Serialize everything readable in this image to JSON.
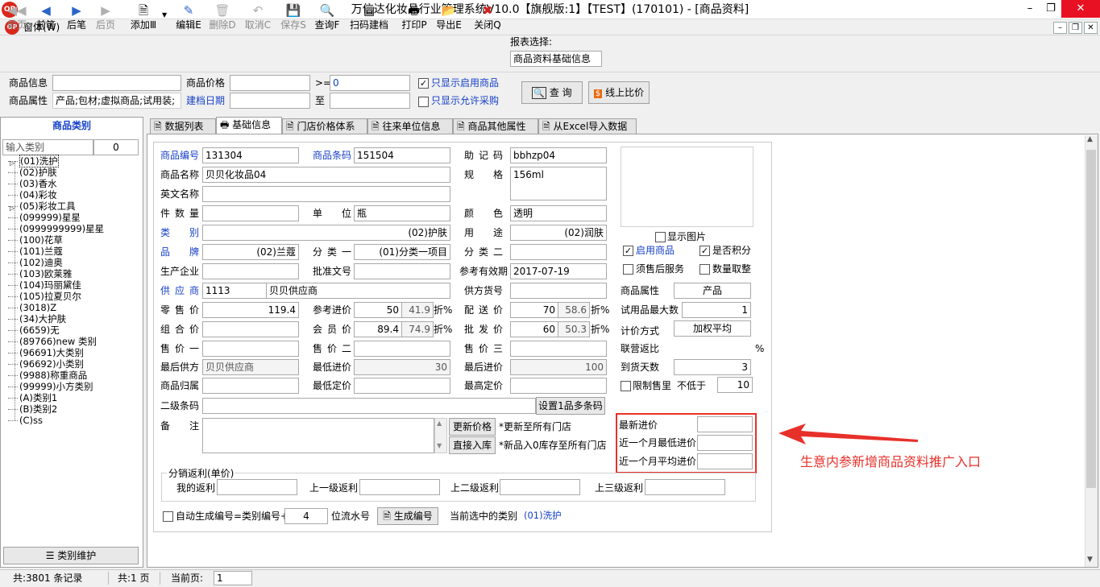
{
  "window": {
    "title": "万信达化妆品行业管理系统V10.0【旗舰版:1】【TEST】(170101) - [商品资料]",
    "menu_label": "窗体(W)"
  },
  "toolbar": {
    "buttons": [
      {
        "label": "前页"
      },
      {
        "label": "前笔"
      },
      {
        "label": "后笔"
      },
      {
        "label": "后页"
      },
      {
        "label": "添加Ⅲ"
      },
      {
        "label": "编辑E"
      },
      {
        "label": "删除D"
      },
      {
        "label": "取消C"
      },
      {
        "label": "保存S"
      },
      {
        "label": "查询F"
      },
      {
        "label": "扫码建档"
      },
      {
        "label": "打印P"
      },
      {
        "label": "导出E"
      },
      {
        "label": "关闭Q"
      }
    ],
    "report_label": "报表选择:",
    "report_value": "商品资料基础信息"
  },
  "filter": {
    "goods_info_label": "商品信息",
    "goods_price_label": "商品价格",
    "ge_label": ">=",
    "price_value": "0",
    "only_enabled_label": "只显示启用商品",
    "goods_attr_label": "商品属性",
    "goods_attr_value": "产品;包材;虚拟商品;试用装;",
    "create_date_label": "建档日期",
    "to_label": "至",
    "only_purchase_label": "只显示允许采购",
    "query_btn": "查 询",
    "compare_btn": "线上比价"
  },
  "left": {
    "header": "商品类别",
    "filter_placeholder": "输入类别",
    "filter_count": "0",
    "categories": [
      "(01)洗护",
      "(02)护肤",
      "(03)香水",
      "(04)彩妆",
      "(05)彩妆工具",
      "(099999)星星",
      "(0999999999)星星",
      "(100)花草",
      "(101)兰蔻",
      "(102)迪奥",
      "(103)欧莱雅",
      "(104)玛丽黛佳",
      "(105)拉夏贝尔",
      "(3018)Z",
      "(34)大护肤",
      "(6659)无",
      "(89766)new 类别",
      "(96691)大类别",
      "(96692)小类别",
      "(9988)称重商品",
      "(99999)小方类别",
      "(A)类别1",
      "(B)类别2",
      "(C)ss"
    ],
    "maintain_btn": "类别维护"
  },
  "tabs": [
    "数据列表",
    "基础信息",
    "门店价格体系",
    "往来单位信息",
    "商品其他属性",
    "从Excel导入数据"
  ],
  "form": {
    "code_label": "商品编号",
    "code": "131304",
    "barcode_label": "商品条码",
    "barcode": "151504",
    "mnemonic_label": "助 记 码",
    "mnemonic": "bbhzp04",
    "name_label": "商品名称",
    "name": "贝贝化妆品04",
    "spec_label": "规 格",
    "spec": "156ml",
    "en_name_label": "英文名称",
    "pieces_label": "件 数 量",
    "unit_label": "单 位",
    "unit": "瓶",
    "color_label": "颜 色",
    "color": "透明",
    "category_label": "类 别",
    "category": "(02)护肤",
    "usage_label": "用 途",
    "usage": "(02)润肤",
    "brand_label": "品 牌",
    "brand": "(02)兰蔻",
    "class1_label": "分 类 一",
    "class1": "(01)分类一项目",
    "class2_label": "分 类 二",
    "manufacturer_label": "生产企业",
    "approval_label": "批准文号",
    "expiry_label": "参考有效期",
    "expiry": "2017-07-19",
    "supplier_label": "供 应 商",
    "supplier_code": "1113",
    "supplier_name": "贝贝供应商",
    "supplier_sku_label": "供方货号",
    "retail_label": "零 售 价",
    "retail": "119.4",
    "ref_cost_label": "参考进价",
    "ref_cost": "50",
    "ref_cost_pct": "41.9",
    "delivery_label": "配 送 价",
    "delivery": "70",
    "delivery_pct": "58.6",
    "combo_label": "组 合 价",
    "member_label": "会 员 价",
    "member": "89.4",
    "member_pct": "74.9",
    "wholesale_label": "批 发 价",
    "wholesale": "60",
    "wholesale_pct": "50.3",
    "discount_label": "折%",
    "price1_label": "售 价 一",
    "price2_label": "售 价 二",
    "price3_label": "售 价 三",
    "last_supplier_label": "最后供方",
    "last_supplier": "贝贝供应商",
    "min_cost_label": "最低进价",
    "min_cost": "30",
    "last_cost_label": "最后进价",
    "last_cost": "100",
    "owner_label": "商品归属",
    "min_price_label": "最低定价",
    "max_price_label": "最高定价",
    "sub_barcode_label": "二级条码",
    "multi_barcode_btn": "设置1品多条码",
    "remark_label": "备 注",
    "update_price_btn": "更新价格",
    "update_price_note": "*更新至所有门店",
    "direct_in_btn": "直接入库",
    "direct_in_note": "*新品入0库存至所有门店",
    "show_image_label": "显示图片",
    "enabled_label": "启用商品",
    "points_label": "是否积分",
    "after_service_label": "须售后服务",
    "round_qty_label": "数量取整",
    "attr_label": "商品属性",
    "attr": "产品",
    "trial_max_label": "试用品最大数",
    "trial_max": "1",
    "valuation_label": "计价方式",
    "valuation": "加权平均",
    "joint_rebate_label": "联营返比",
    "pct_sign": "%",
    "arrival_days_label": "到货天数",
    "arrival_days": "3",
    "limit_sale_label": "限制售里",
    "not_below_label": "不低于",
    "not_below": "10",
    "latest_cost_label": "最新进价",
    "month_min_cost_label": "近一个月最低进价",
    "month_avg_cost_label": "近一个月平均进价",
    "annotation": "生意内参新增商品资料推广入口",
    "rebate_group_label": "分销返利(单价)",
    "my_rebate_label": "我的返利",
    "l1_rebate_label": "上一级返利",
    "l2_rebate_label": "上二级返利",
    "l3_rebate_label": "上三级返利",
    "auto_code_label": "自动生成编号=类别编号+",
    "auto_code_digits": "4",
    "serial_label": "位流水号",
    "gen_code_btn": "生成编号",
    "current_cat_label": "当前选中的类别",
    "current_cat": "(01)洗护"
  },
  "status": {
    "total_records": "共:3801 条记录",
    "total_pages": "共:1 页",
    "current_page_label": "当前页:",
    "current_page": "1"
  },
  "colors": {
    "accent_blue": "#1640c8",
    "annotation_red": "#e8302a",
    "close_red": "#e81123"
  }
}
